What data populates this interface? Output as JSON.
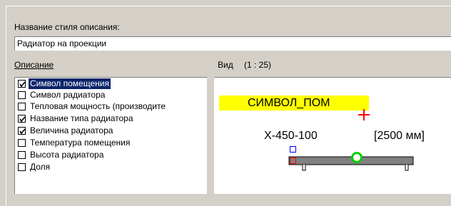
{
  "dialog": {
    "name_label": "Название стиля описания:",
    "name_value": "Радиатор на проекции",
    "description_label": "Описание",
    "view_label": "Вид",
    "view_scale": "(1 : 25)"
  },
  "items": [
    {
      "label": "Символ помещения",
      "checked": true,
      "selected": true
    },
    {
      "label": "Символ радиатора",
      "checked": false,
      "selected": false
    },
    {
      "label": "Тепловая мощность (производите",
      "checked": false,
      "selected": false
    },
    {
      "label": "Название типа радиатора",
      "checked": true,
      "selected": false
    },
    {
      "label": "Величина радиатора",
      "checked": true,
      "selected": false
    },
    {
      "label": "Температура помещения",
      "checked": false,
      "selected": false
    },
    {
      "label": "Высота радиатора",
      "checked": false,
      "selected": false
    },
    {
      "label": "Доля",
      "checked": false,
      "selected": false
    }
  ],
  "preview": {
    "room_symbol_text": "СИМВОЛ_ПОМ",
    "radiator_type_text": "X-450-100",
    "radiator_size_text": "[2500 мм]",
    "colors": {
      "room_symbol_bg": "#ffff00",
      "cross": "#ff0000",
      "grip": "#00cc00",
      "radiator_fill": "#808080"
    }
  }
}
